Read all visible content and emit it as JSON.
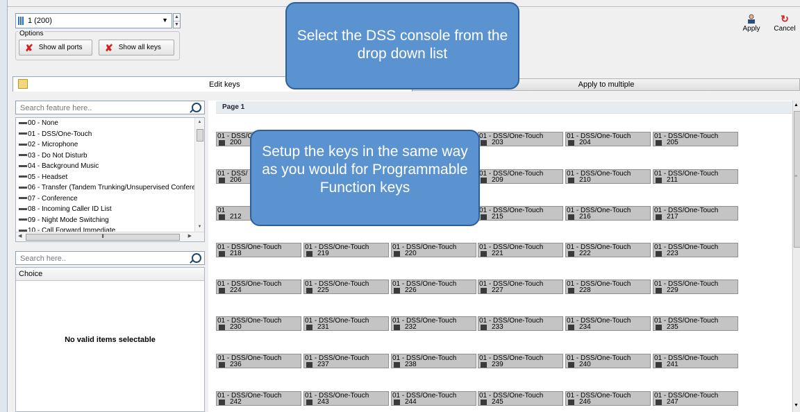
{
  "console_select": {
    "value": "1 (200)"
  },
  "options": {
    "label": "Options",
    "show_all_ports": "Show all ports",
    "show_all_keys": "Show all keys"
  },
  "actions": {
    "apply": "Apply",
    "cancel": "Cancel"
  },
  "tabs": {
    "edit_keys": "Edit keys",
    "apply_to_multiple": "Apply to multiple"
  },
  "feature_search": {
    "placeholder": "Search feature here.."
  },
  "features": [
    "00 - None",
    "01 - DSS/One-Touch",
    "02 - Microphone",
    "03 - Do Not Disturb",
    "04 - Background Music",
    "05 - Headset",
    "06 - Transfer (Tandem Trunking/Unsupervised Confere",
    "07 - Conference",
    "08 - Incoming Caller ID List",
    "09 - Night Mode Switching",
    "10 - Call Forward Immediate"
  ],
  "choice_search": {
    "placeholder": "Search here.."
  },
  "choice": {
    "header": "Choice",
    "empty_text": "No valid items selectable"
  },
  "page": {
    "label": "Page 1"
  },
  "keys": [
    {
      "fn": "01 - DSS/O",
      "num": "200"
    },
    {
      "fn": "01 - DSS/One-Touch",
      "num": "203"
    },
    {
      "fn": "01 - DSS/One-Touch",
      "num": "204"
    },
    {
      "fn": "01 - DSS/One-Touch",
      "num": "205"
    },
    {
      "fn": "01 - DSS/",
      "num": "206"
    },
    {
      "fn": "01 - DSS/One-Touch",
      "num": "209"
    },
    {
      "fn": "01 - DSS/One-Touch",
      "num": "210"
    },
    {
      "fn": "01 - DSS/One-Touch",
      "num": "211"
    },
    {
      "fn": "01",
      "num": "212"
    },
    {
      "fn": "01 - DSS/One-Touch",
      "num": "215"
    },
    {
      "fn": "01 - DSS/One-Touch",
      "num": "216"
    },
    {
      "fn": "01 - DSS/One-Touch",
      "num": "217"
    },
    {
      "fn": "01 - DSS/One-Touch",
      "num": "218"
    },
    {
      "fn": "01 - DSS/One-Touch",
      "num": "219"
    },
    {
      "fn": "01 - DSS/One-Touch",
      "num": "220"
    },
    {
      "fn": "01 - DSS/One-Touch",
      "num": "221"
    },
    {
      "fn": "01 - DSS/One-Touch",
      "num": "222"
    },
    {
      "fn": "01 - DSS/One-Touch",
      "num": "223"
    },
    {
      "fn": "01 - DSS/One-Touch",
      "num": "224"
    },
    {
      "fn": "01 - DSS/One-Touch",
      "num": "225"
    },
    {
      "fn": "01 - DSS/One-Touch",
      "num": "226"
    },
    {
      "fn": "01 - DSS/One-Touch",
      "num": "227"
    },
    {
      "fn": "01 - DSS/One-Touch",
      "num": "228"
    },
    {
      "fn": "01 - DSS/One-Touch",
      "num": "229"
    },
    {
      "fn": "01 - DSS/One-Touch",
      "num": "230"
    },
    {
      "fn": "01 - DSS/One-Touch",
      "num": "231"
    },
    {
      "fn": "01 - DSS/One-Touch",
      "num": "232"
    },
    {
      "fn": "01 - DSS/One-Touch",
      "num": "233"
    },
    {
      "fn": "01 - DSS/One-Touch",
      "num": "234"
    },
    {
      "fn": "01 - DSS/One-Touch",
      "num": "235"
    },
    {
      "fn": "01 - DSS/One-Touch",
      "num": "236"
    },
    {
      "fn": "01 - DSS/One-Touch",
      "num": "237"
    },
    {
      "fn": "01 - DSS/One-Touch",
      "num": "238"
    },
    {
      "fn": "01 - DSS/One-Touch",
      "num": "239"
    },
    {
      "fn": "01 - DSS/One-Touch",
      "num": "240"
    },
    {
      "fn": "01 - DSS/One-Touch",
      "num": "241"
    },
    {
      "fn": "01 - DSS/One-Touch",
      "num": "242"
    },
    {
      "fn": "01 - DSS/One-Touch",
      "num": "243"
    },
    {
      "fn": "01 - DSS/One-Touch",
      "num": "244"
    },
    {
      "fn": "01 - DSS/One-Touch",
      "num": "245"
    },
    {
      "fn": "01 - DSS/One-Touch",
      "num": "246"
    },
    {
      "fn": "01 - DSS/One-Touch",
      "num": "247"
    }
  ],
  "callouts": {
    "top": "Select the DSS console from the drop down list",
    "middle": "Setup the keys in the same way as you would for Programmable Function keys"
  },
  "colors": {
    "callout_fill": "#5b93d1",
    "callout_border": "#2d5f9a",
    "key_fill": "#c4c4c4"
  }
}
